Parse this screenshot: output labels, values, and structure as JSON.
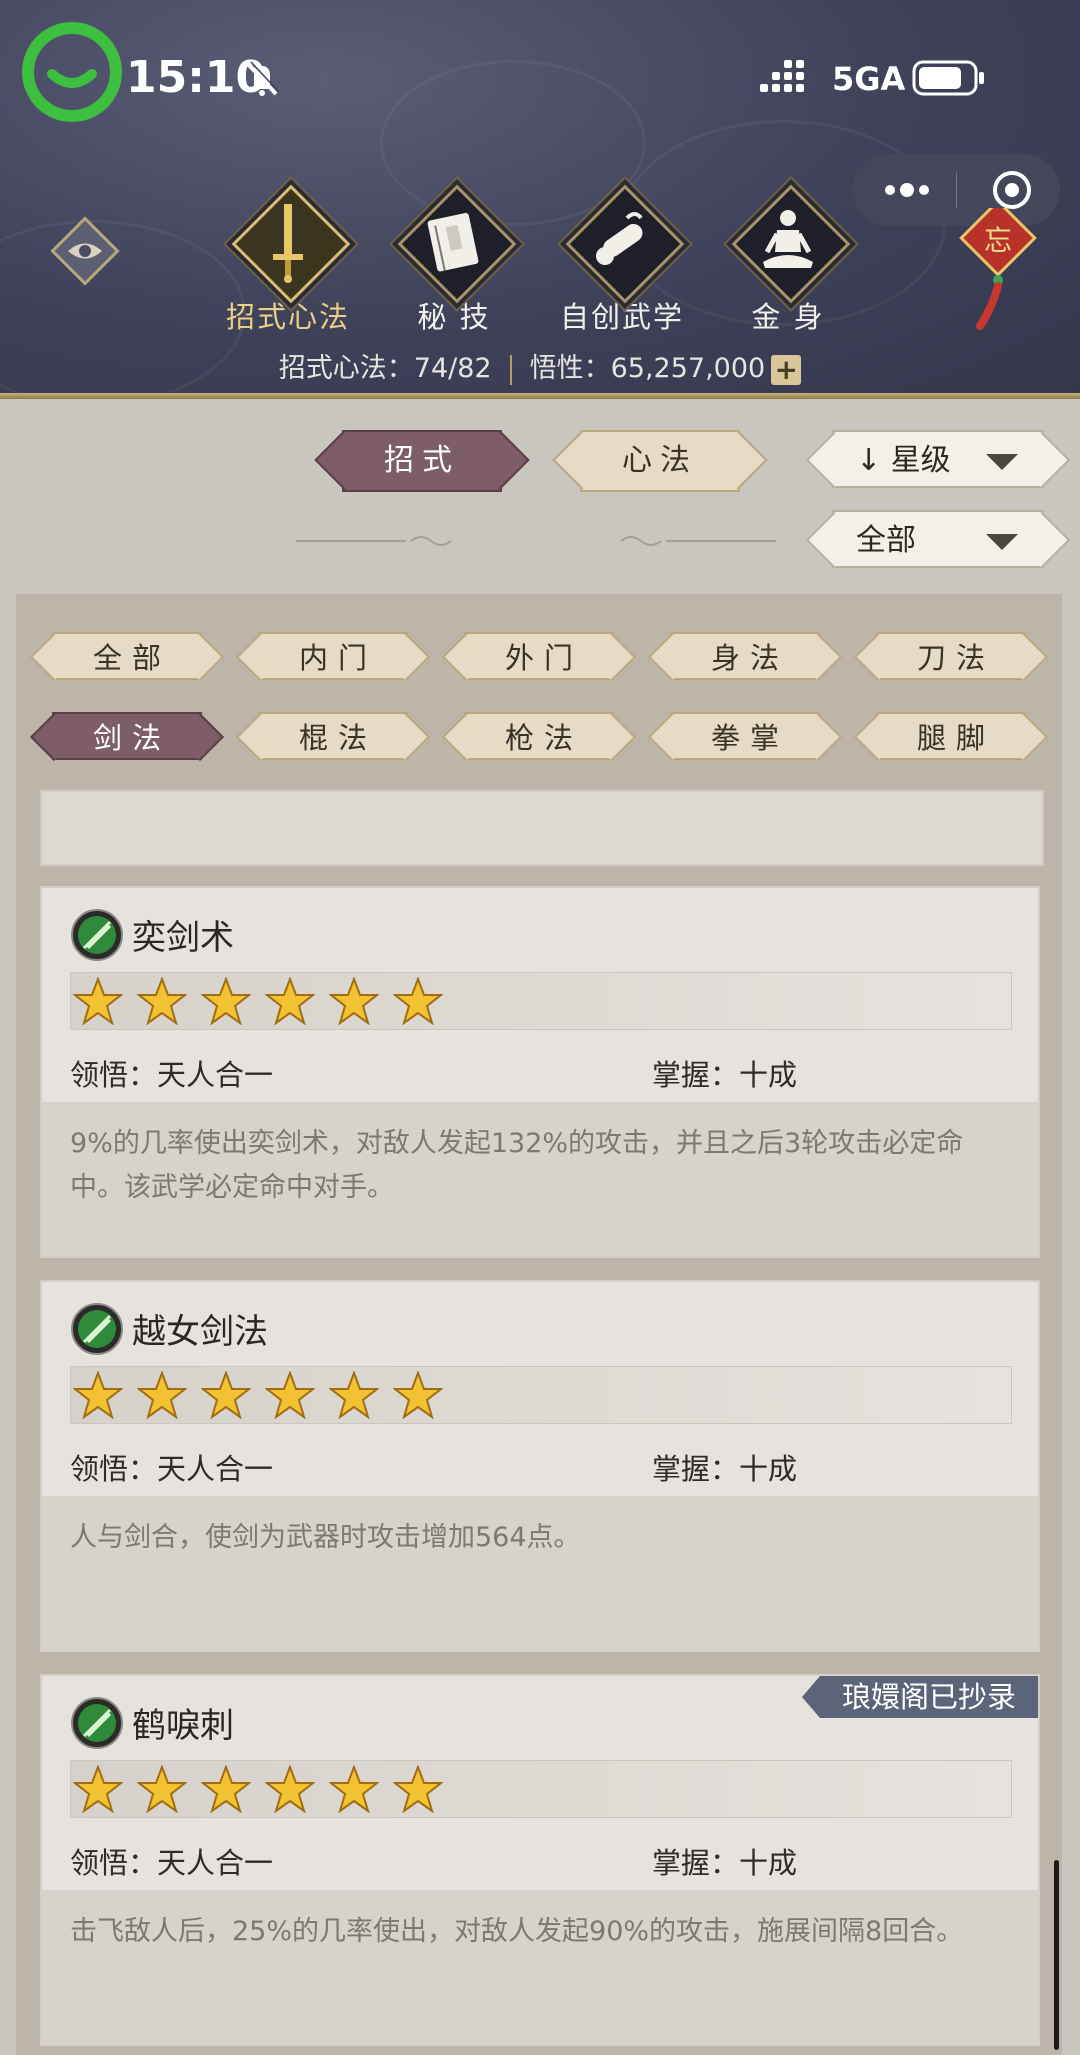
{
  "status_bar": {
    "time": "15:10",
    "network": "5GA"
  },
  "nav": {
    "tabs": [
      {
        "label": "招式心法",
        "icon": "sword-icon",
        "active": true
      },
      {
        "label": "秘 技",
        "icon": "book-icon",
        "active": false
      },
      {
        "label": "自创武学",
        "icon": "scroll-icon",
        "active": false
      },
      {
        "label": "金 身",
        "icon": "meditation-icon",
        "active": false
      }
    ],
    "talisman_char": "忘"
  },
  "stats": {
    "moves_label": "招式心法：74/82",
    "insight_label": "悟性：65,257,000",
    "plus": "+"
  },
  "toggle": {
    "moves": "招式",
    "mind": "心法",
    "active": "moves"
  },
  "sort": {
    "label": "星级",
    "arrow": "↓"
  },
  "filter": {
    "label": "全部"
  },
  "categories": [
    {
      "label": "全部"
    },
    {
      "label": "内门"
    },
    {
      "label": "外门"
    },
    {
      "label": "身法"
    },
    {
      "label": "刀法"
    },
    {
      "label": "剑法",
      "active": true
    },
    {
      "label": "棍法"
    },
    {
      "label": "枪法"
    },
    {
      "label": "拳掌"
    },
    {
      "label": "腿脚"
    }
  ],
  "skills": [
    {
      "name": "奕剑术",
      "stars": 6,
      "comprehension": "领悟：天人合一",
      "mastery": "掌握：十成",
      "description": "9%的几率使出奕剑术，对敌人发起132%的攻击，并且之后3轮攻击必定命中。该武学必定命中对手。",
      "badge": ""
    },
    {
      "name": "越女剑法",
      "stars": 6,
      "comprehension": "领悟：天人合一",
      "mastery": "掌握：十成",
      "description": "人与剑合，使剑为武器时攻击增加564点。",
      "badge": ""
    },
    {
      "name": "鹤唳刺",
      "stars": 6,
      "comprehension": "领悟：天人合一",
      "mastery": "掌握：十成",
      "description": "击飞敌人后，25%的几率使出，对敌人发起90%的攻击，施展间隔8回合。",
      "badge": "琅嬛阁已抄录"
    }
  ],
  "colors": {
    "accent_active": "#7c5d68",
    "gold": "#d9bd72",
    "ribbon": "#5b6478"
  }
}
